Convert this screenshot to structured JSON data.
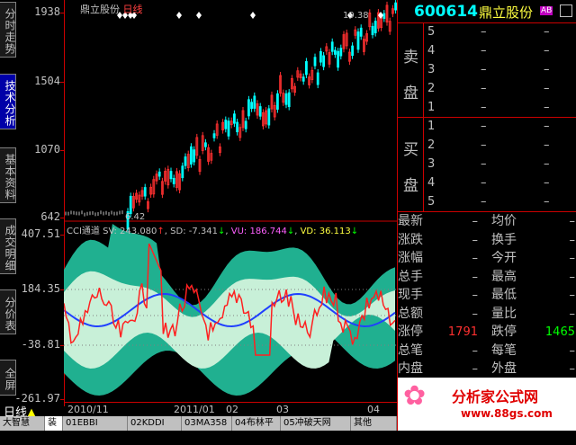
{
  "side_tabs": [
    {
      "label": "分时走势",
      "active": false
    },
    {
      "label": "技术分析",
      "active": true
    },
    {
      "label": "基本资料",
      "active": false
    },
    {
      "label": "成交明细",
      "active": false
    },
    {
      "label": "分价表",
      "active": false
    },
    {
      "label": "全屏",
      "active": false
    }
  ],
  "price_axis": {
    "labels": [
      "1938",
      "1504",
      "1070",
      "642"
    ]
  },
  "cci_axis": {
    "labels": [
      "407.51",
      "184.35",
      "-38.81",
      "-261.97"
    ]
  },
  "chart_header": {
    "name": "鼎立股份",
    "period": "日线"
  },
  "annotations": {
    "high": "19.38",
    "low": "6.42"
  },
  "cci_header": {
    "indicator": "CCI通道",
    "sv_label": "SV:",
    "sv": "243.080",
    "sd_label": "SD:",
    "sd": "-7.341",
    "vu_label": "VU:",
    "vu": "186.744",
    "vd_label": "VD:",
    "vd": "36.113"
  },
  "date_axis": {
    "labels": [
      "2010/11",
      "2011/01",
      "02",
      "03",
      "04"
    ]
  },
  "period_label": "日线",
  "bottom_tabs": [
    "大智慧",
    "装",
    "01EBBI",
    "02KDDI",
    "03MA358",
    "04布林平衡",
    "05冲破天网",
    "其他"
  ],
  "stock": {
    "code": "600614",
    "name": "鼎立股份",
    "badge": "AB"
  },
  "order_book": {
    "sell_label": [
      "卖",
      "盘"
    ],
    "buy_label": [
      "买",
      "盘"
    ],
    "sell_levels": [
      "5",
      "4",
      "3",
      "2",
      "1"
    ],
    "buy_levels": [
      "1",
      "2",
      "3",
      "4",
      "5"
    ],
    "dash": "–"
  },
  "quote": [
    {
      "l": "最新",
      "lv": "–",
      "r": "均价",
      "rv": "–"
    },
    {
      "l": "涨跌",
      "lv": "–",
      "r": "换手",
      "rv": "–"
    },
    {
      "l": "涨幅",
      "lv": "–",
      "r": "今开",
      "rv": "–"
    },
    {
      "l": "总手",
      "lv": "–",
      "r": "最高",
      "rv": "–"
    },
    {
      "l": "现手",
      "lv": "–",
      "r": "最低",
      "rv": "–"
    },
    {
      "l": "总额",
      "lv": "–",
      "r": "量比",
      "rv": "–"
    },
    {
      "l": "涨停",
      "lv": "1791",
      "r": "跌停",
      "rv": "1465"
    },
    {
      "l": "总笔",
      "lv": "–",
      "r": "每笔",
      "rv": "–"
    },
    {
      "l": "内盘",
      "lv": "–",
      "r": "外盘",
      "rv": "–"
    }
  ],
  "logo": {
    "text": "分析家公式网",
    "url": "www.88gs.com"
  },
  "colors": {
    "up": "#ff3030",
    "down": "#00ffff",
    "band": "#20b090",
    "band_light": "#c8f0d8",
    "cci": "#ff2020",
    "mid": "#2040ff",
    "accent": "#00ffff"
  }
}
